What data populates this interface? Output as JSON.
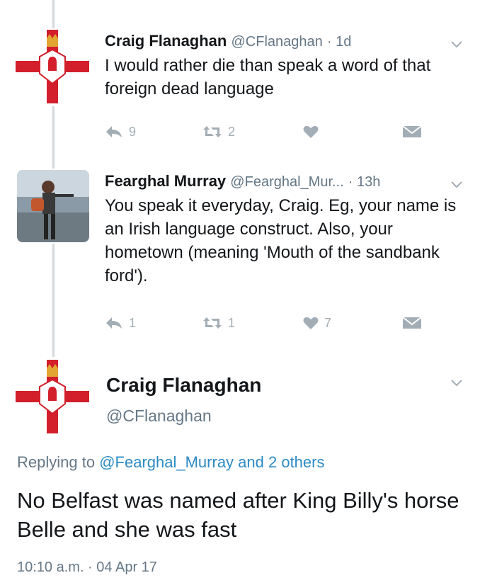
{
  "tweets": [
    {
      "name": "Craig Flanaghan",
      "handle": "@CFlanaghan",
      "time": "· 1d",
      "text": "I would rather die than speak a word of that foreign dead language",
      "reply_count": "9",
      "retweet_count": "2",
      "like_count": "",
      "avatar": "northern-ireland-flag"
    },
    {
      "name": "Fearghal Murray",
      "handle": "@Fearghal_Mur...",
      "time": "· 13h",
      "text": "You speak it everyday, Craig. Eg, your name is an Irish language construct. Also, your hometown (meaning 'Mouth of the sandbank ford').",
      "reply_count": "1",
      "retweet_count": "1",
      "like_count": "7",
      "avatar": "photo"
    }
  ],
  "focused": {
    "name": "Craig Flanaghan",
    "handle": "@CFlanaghan",
    "replying_prefix": "Replying to",
    "replying_to": "@Fearghal_Murray and 2 others",
    "text": "No Belfast was named after King Billy's horse Belle and she was fast",
    "timestamp": "10:10 a.m. · 04 Apr 17",
    "avatar": "northern-ireland-flag"
  },
  "colors": {
    "icon_gray": "#a3adb5",
    "secondary_text": "#657786",
    "link": "#2c8bc4",
    "flag_red": "#d21f2b",
    "thread_line": "#d2d8dc"
  }
}
